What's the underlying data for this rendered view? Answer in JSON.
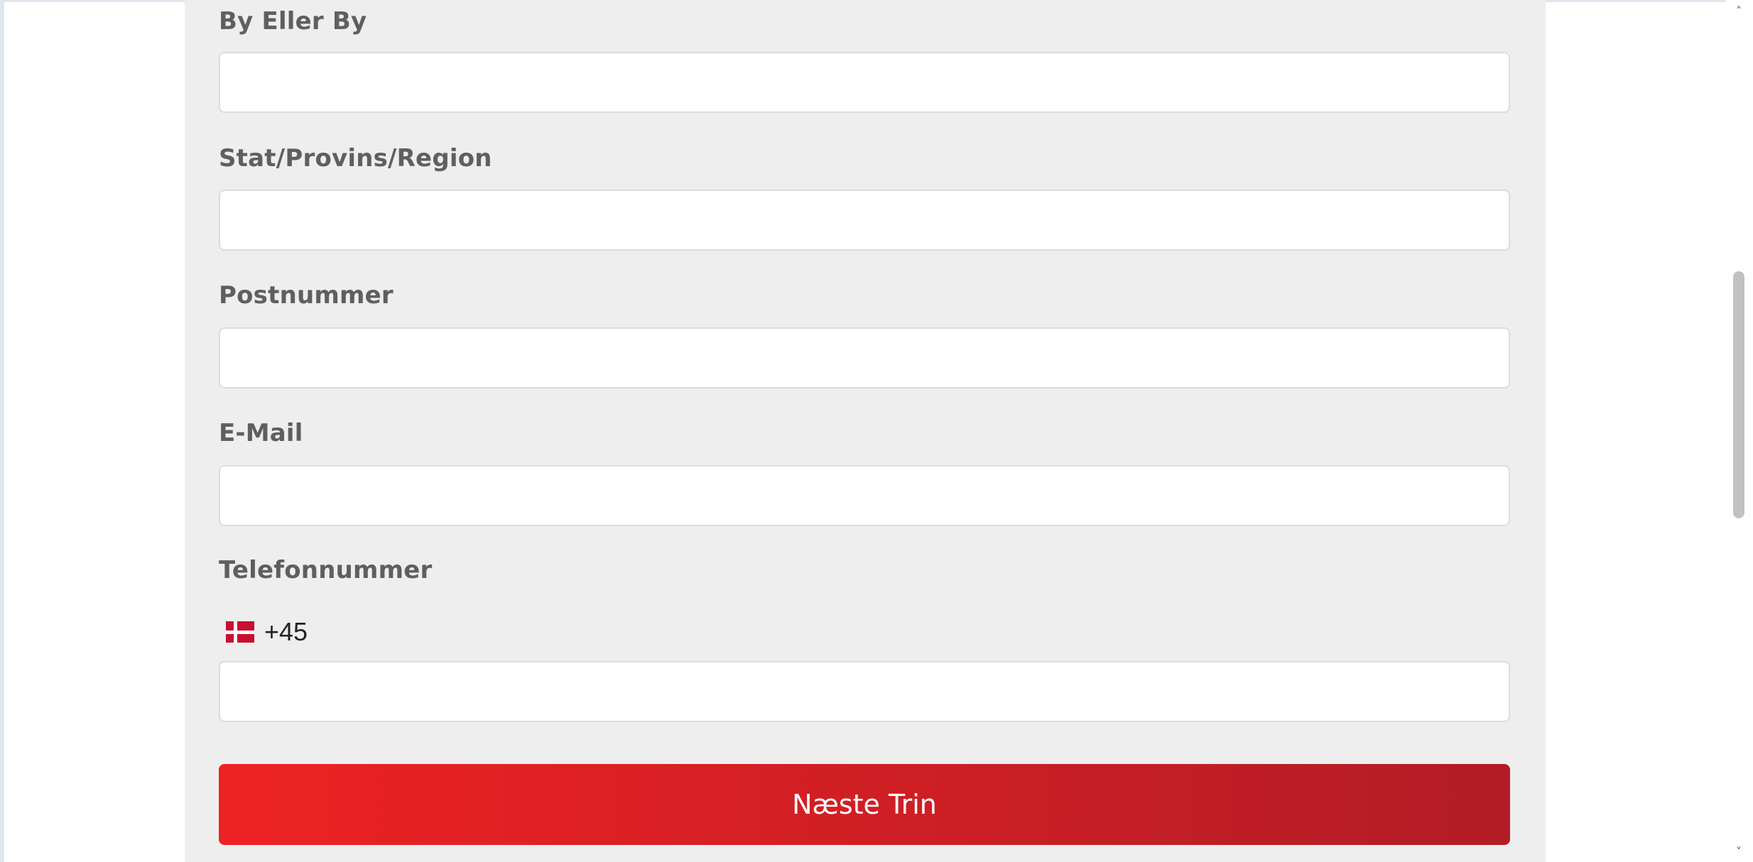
{
  "form": {
    "fields": [
      {
        "label": "By Eller By",
        "value": ""
      },
      {
        "label": "Stat/Provins/Region",
        "value": ""
      },
      {
        "label": "Postnummer",
        "value": ""
      },
      {
        "label": "E-Mail",
        "value": ""
      },
      {
        "label": "Telefonnummer",
        "value": ""
      }
    ],
    "phone": {
      "flag_icon": "denmark-flag-icon",
      "dial_code": "+45"
    },
    "next_button_label": "Næste Trin"
  },
  "scrollbar": {
    "up_icon": "chevron-up-icon",
    "down_icon": "chevron-down-icon",
    "up_glyph": "˄",
    "down_glyph": "˅"
  },
  "colors": {
    "panel_bg": "#eeeeee",
    "label_text": "#5f5f5f",
    "button_gradient_start": "#ee2224",
    "button_gradient_end": "#b21c25",
    "flag_red": "#c8102e"
  }
}
